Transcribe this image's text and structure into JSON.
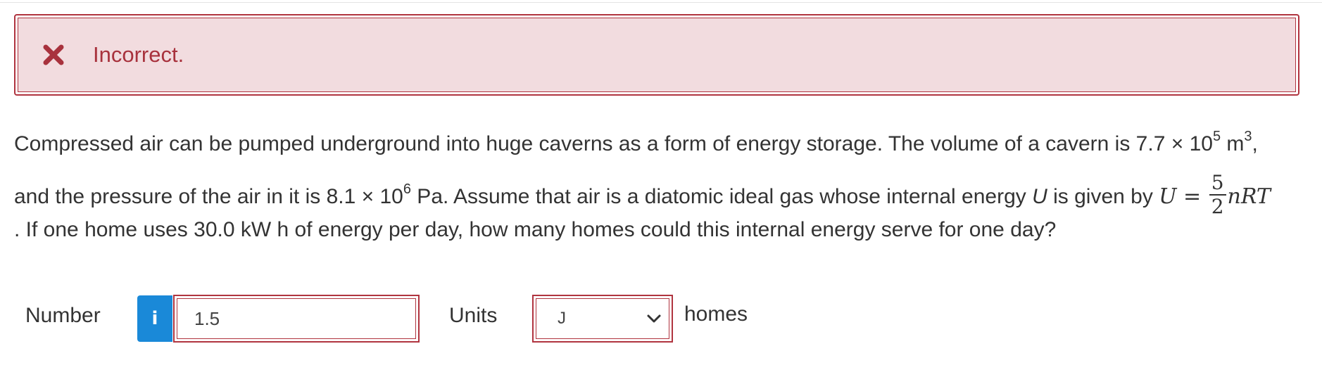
{
  "feedback": {
    "status": "Incorrect.",
    "icon": "close-icon",
    "color": "#a8323d",
    "background": "#f2dcdf"
  },
  "question": {
    "line1_a": "Compressed air can be pumped underground into huge caverns as a form of energy storage. The volume of a cavern is 7.7 × 10",
    "line1_exp1": "5",
    "line1_b": " m",
    "line1_exp2": "3",
    "line1_c": ",",
    "line2_a": "and the pressure of the air in it is 8.1 × 10",
    "line2_exp": "6",
    "line2_b": " Pa. Assume that air is a diatomic ideal gas whose internal energy ",
    "line2_var": "U",
    "line2_c": " is given by ",
    "formula_lhs": "U",
    "formula_eq": " = ",
    "formula_num": "5",
    "formula_den": "2",
    "formula_rhs": "nRT",
    "line3": ". If one home uses 30.0 kW h of energy per day, how many homes could this internal energy serve for one day?"
  },
  "answer": {
    "number_label": "Number",
    "info_glyph": "i",
    "number_value": "1.5",
    "units_label": "Units",
    "units_value": "J",
    "units_suffix": "homes",
    "info_color": "#1a89d8",
    "error_color": "#b0343f"
  }
}
